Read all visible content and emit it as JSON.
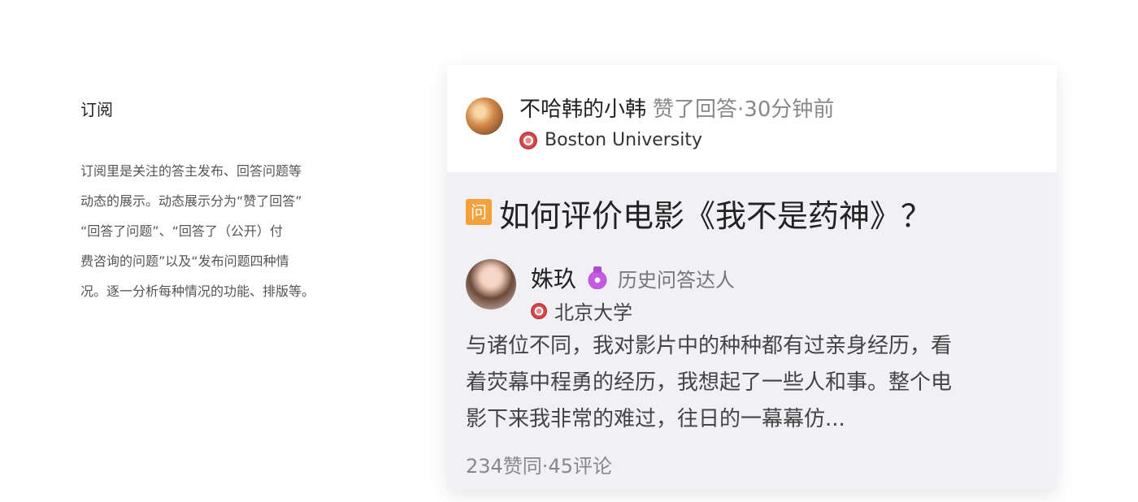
{
  "intro": {
    "title": "订阅",
    "lines": [
      "订阅里是关注的答主发布、回答问题等",
      "动态的展示。动态展示分为“赞了回答”",
      "“回答了问题”、“回答了（公开）付",
      "费咨询的问题”以及“发布问题四种情",
      "况。逐一分析每种情况的功能、排版等。"
    ]
  },
  "feed": {
    "actor_name": "不哈韩的小韩",
    "action": "赞了回答·30分钟前",
    "actor_school": "Boston University",
    "question_badge": "问",
    "question_title": "如何评价电影《我不是药神》？",
    "answerer_name": "姝玖",
    "answerer_title": "历史问答达人",
    "answerer_school": "北京大学",
    "answer_lines": [
      "与诸位不同，我对影片中的种种都有过亲身经历，看",
      "着荧幕中程勇的经历，我想起了一些人和事。整个电",
      "影下来我非常的难过，往日的一幕幕仿..."
    ],
    "stats": "234赞同·45评论"
  },
  "colors": {
    "badge": "#f2a13b",
    "medal": "#c45ce0",
    "card_body": "#f1f1f5"
  }
}
